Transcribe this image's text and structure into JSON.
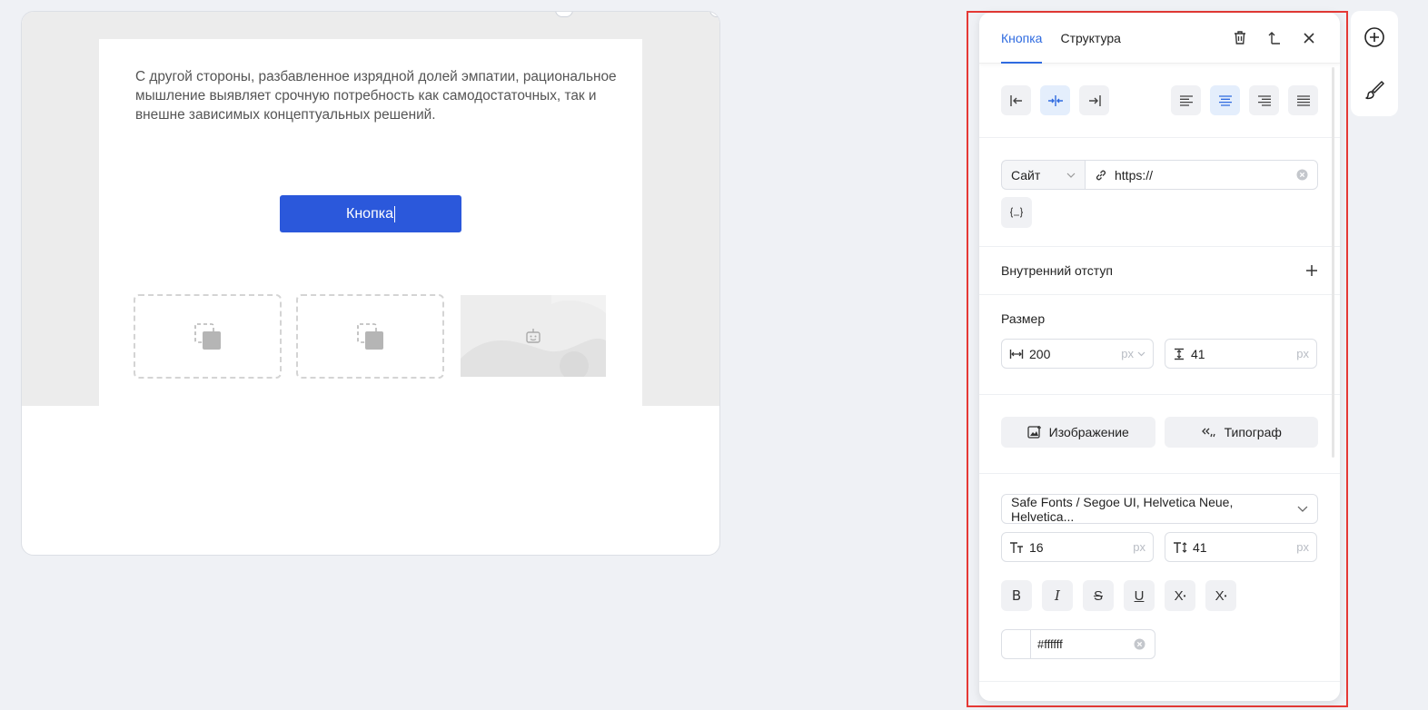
{
  "canvas": {
    "text": "С другой стороны, разбавленное изрядной долей эмпатии, рациональное мышление выявляет срочную потребность как самодостаточных, так и внешне зависимых концептуальных решений.",
    "button_label": "Кнопка"
  },
  "panel": {
    "tabs": [
      {
        "label": "Кнопка",
        "active": true
      },
      {
        "label": "Структура",
        "active": false
      }
    ],
    "actions": [
      "trash-icon",
      "up-level-icon",
      "close-icon"
    ],
    "link": {
      "type": "Сайт",
      "url": "https://"
    },
    "padding_label": "Внутренний отступ",
    "size": {
      "title": "Размер",
      "width": "200",
      "width_unit": "px",
      "height": "41",
      "height_unit": "px"
    },
    "image_button": "Изображение",
    "typograph_button": "Типограф",
    "font": {
      "family": "Safe Fonts / Segoe UI, Helvetica Neue, Helvetica...",
      "size": "16",
      "size_unit": "px",
      "line_height": "41",
      "line_height_unit": "px"
    },
    "format_buttons": [
      "B",
      "I",
      "S",
      "U",
      "X",
      "X"
    ],
    "color": "#ffffff"
  },
  "colors": {
    "accent": "#2f6be0",
    "button_bg": "#2b58db",
    "highlight_border": "#e53935"
  }
}
